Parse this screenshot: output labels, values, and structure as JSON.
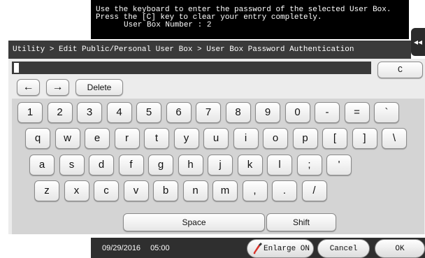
{
  "message": {
    "line1": "Use the keyboard to enter the password of the selected User Box.",
    "line2": "Press the [C] key to clear your entry completely.",
    "line3": "User Box Number : 2"
  },
  "side_tab": {
    "icon": "double-chevron-left-icon",
    "glyph": "◂◂"
  },
  "breadcrumb": "Utility > Edit Public/Personal User Box > User Box Password Authentication",
  "password_field": {
    "value": ""
  },
  "controls": {
    "clear_label": "C",
    "left_arrow": "←",
    "right_arrow": "→",
    "delete_label": "Delete"
  },
  "keyboard": {
    "row1": [
      "1",
      "2",
      "3",
      "4",
      "5",
      "6",
      "7",
      "8",
      "9",
      "0",
      "-",
      "=",
      "`"
    ],
    "row2": [
      "q",
      "w",
      "e",
      "r",
      "t",
      "y",
      "u",
      "i",
      "o",
      "p",
      "[",
      "]",
      "\\"
    ],
    "row3": [
      "a",
      "s",
      "d",
      "f",
      "g",
      "h",
      "j",
      "k",
      "l",
      ";",
      "'"
    ],
    "row4": [
      "z",
      "x",
      "c",
      "v",
      "b",
      "n",
      "m",
      ",",
      ".",
      "/"
    ],
    "space_label": "Space",
    "shift_label": "Shift"
  },
  "footer": {
    "date": "09/29/2016",
    "time": "05:00",
    "enlarge_label": "Enlarge ON",
    "cancel_label": "Cancel",
    "ok_label": "OK"
  },
  "colors": {
    "message_bg": "#000000",
    "breadcrumb_bg": "#3a3a3a",
    "keyboard_bg": "#d4d4d4",
    "panel_bg": "#ececec",
    "footer_bg": "#2f2f2f"
  }
}
